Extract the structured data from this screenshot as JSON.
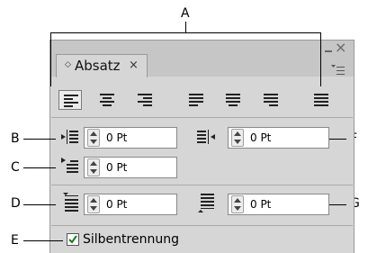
{
  "callouts": {
    "A": "A",
    "B": "B",
    "C": "C",
    "D": "D",
    "E": "E",
    "F": "F",
    "G": "G"
  },
  "panel": {
    "tab_label": "Absatz",
    "tab_close": "×",
    "tab_diamond": "◇",
    "window_close": "×",
    "alignment_buttons": [
      {
        "name": "align-left",
        "active": true
      },
      {
        "name": "align-center",
        "active": false
      },
      {
        "name": "align-right",
        "active": false
      },
      {
        "name": "justify-last-left",
        "active": false
      },
      {
        "name": "justify-last-center",
        "active": false
      },
      {
        "name": "justify-last-right",
        "active": false
      },
      {
        "name": "justify-all",
        "active": false
      }
    ],
    "left_indent": "0 Pt",
    "right_indent": "0 Pt",
    "first_line_indent": "0 Pt",
    "space_before": "0 Pt",
    "space_after": "0 Pt",
    "hyphenation_label": "Silbentrennung",
    "hyphenation_checked": true
  }
}
